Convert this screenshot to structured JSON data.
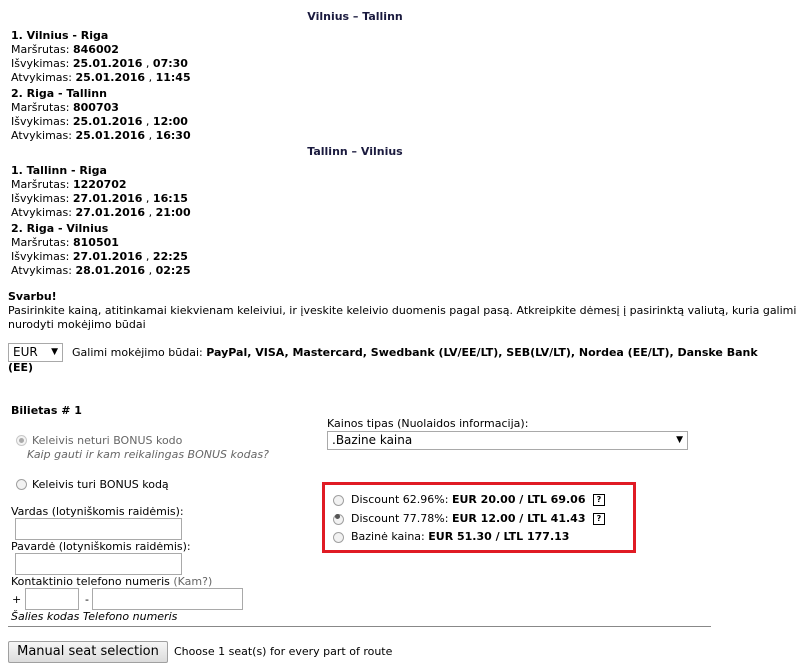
{
  "routes": [
    {
      "direction": "Vilnius – Tallinn",
      "segments": [
        {
          "title": "1. Vilnius - Riga",
          "route_label": "Maršrutas:",
          "route_no": "846002",
          "dep_label": "Išvykimas:",
          "dep_date": "25.01.2016",
          "dep_time": "07:30",
          "arr_label": "Atvykimas:",
          "arr_date": "25.01.2016",
          "arr_time": "11:45"
        },
        {
          "title": "2. Riga - Tallinn",
          "route_label": "Maršrutas:",
          "route_no": "800703",
          "dep_label": "Išvykimas:",
          "dep_date": "25.01.2016",
          "dep_time": "12:00",
          "arr_label": "Atvykimas:",
          "arr_date": "25.01.2016",
          "arr_time": "16:30"
        }
      ]
    },
    {
      "direction": "Tallinn – Vilnius",
      "segments": [
        {
          "title": "1. Tallinn - Riga",
          "route_label": "Maršrutas:",
          "route_no": "1220702",
          "dep_label": "Išvykimas:",
          "dep_date": "27.01.2016",
          "dep_time": "16:15",
          "arr_label": "Atvykimas:",
          "arr_date": "27.01.2016",
          "arr_time": "21:00"
        },
        {
          "title": "2. Riga - Vilnius",
          "route_label": "Maršrutas:",
          "route_no": "810501",
          "dep_label": "Išvykimas:",
          "dep_date": "27.01.2016",
          "dep_time": "22:25",
          "arr_label": "Atvykimas:",
          "arr_date": "28.01.2016",
          "arr_time": "02:25"
        }
      ]
    }
  ],
  "notice": {
    "title": "Svarbu!",
    "text_line1": "Pasirinkite kainą, atitinkamai kiekvienam keleiviui, ir įveskite keleivio duomenis pagal pasą. Atkreipkite dėmesį į pasirinktą valiutą, kuria galimi",
    "text_line2": "nurodyti mokėjimo būdai"
  },
  "currency": {
    "selected": "EUR",
    "payment_label": "Galimi mokėjimo būdai:",
    "payment_methods_line1": "PayPal, VISA, Mastercard, Swedbank (LV/EE/LT), SEB(LV/LT), Nordea (EE/LT), Danske Bank",
    "payment_methods_line2": "(EE)"
  },
  "ticket": {
    "title": "Bilietas # 1",
    "no_bonus_label": "Keleivis neturi BONUS kodo",
    "bonus_help": "Kaip gauti ir kam reikalingas BONUS kodas?",
    "has_bonus_label": "Keleivis turi BONUS kodą",
    "name_label": "Vardas (lotyniškomis raidėmis):",
    "surname_label": "Pavardė (lotyniškomis raidėmis):",
    "phone_label": "Kontaktinio telefono numeris",
    "phone_why": "(Kam?)",
    "plus": "+",
    "dash": "-",
    "phone_hint": "Šalies kodas Telefono numeris",
    "price_type_label": "Kainos tipas (Nuolaidos informacija):",
    "price_type_selected": ".Bazine kaina",
    "discounts": [
      {
        "label": "Discount 62.96%:",
        "price": "EUR 20.00 / LTL 69.06",
        "help": "?",
        "checked": false
      },
      {
        "label": "Discount 77.78%:",
        "price": "EUR 12.00 / LTL 41.43",
        "help": "?",
        "checked": true
      },
      {
        "label": "Bazinė kaina:",
        "price": "EUR 51.30 / LTL 177.13",
        "help": "",
        "checked": false
      }
    ]
  },
  "seat": {
    "button_label": "Manual seat selection",
    "hint": "Choose 1 seat(s) for every part of route"
  },
  "colors": {
    "highlight_border": "#e01b24",
    "direction_title": "#1a1a3e"
  }
}
